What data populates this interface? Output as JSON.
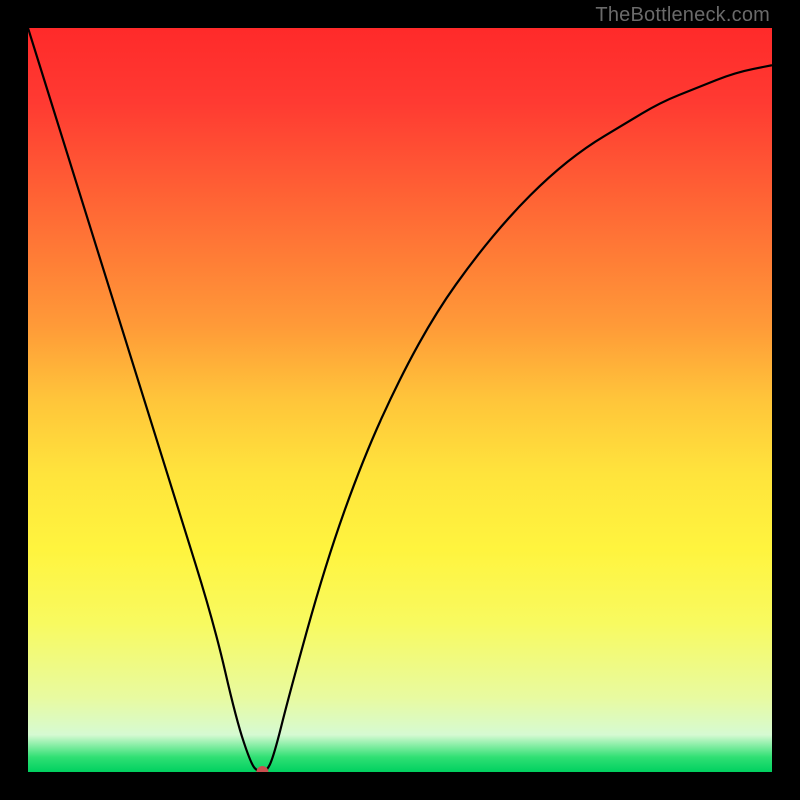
{
  "watermark": "TheBottleneck.com",
  "chart_data": {
    "type": "line",
    "title": "",
    "xlabel": "",
    "ylabel": "",
    "xlim": [
      0,
      100
    ],
    "ylim": [
      0,
      100
    ],
    "gradient_stops": [
      {
        "pct": 0,
        "color": "#ff2a2a"
      },
      {
        "pct": 50,
        "color": "#ffe43c"
      },
      {
        "pct": 95,
        "color": "#d6fad2"
      },
      {
        "pct": 100,
        "color": "#00d060"
      }
    ],
    "series": [
      {
        "name": "bottleneck-curve",
        "x": [
          0,
          5,
          10,
          15,
          20,
          25,
          28,
          30,
          31,
          32,
          33,
          35,
          40,
          45,
          50,
          55,
          60,
          65,
          70,
          75,
          80,
          85,
          90,
          95,
          100
        ],
        "y": [
          100,
          84,
          68,
          52,
          36,
          20,
          7,
          1,
          0,
          0,
          2,
          10,
          28,
          42,
          53,
          62,
          69,
          75,
          80,
          84,
          87,
          90,
          92,
          94,
          95
        ]
      }
    ],
    "marker": {
      "x": 31.5,
      "y": 0,
      "color": "#c94f4f",
      "radius": 6
    },
    "annotations": []
  }
}
